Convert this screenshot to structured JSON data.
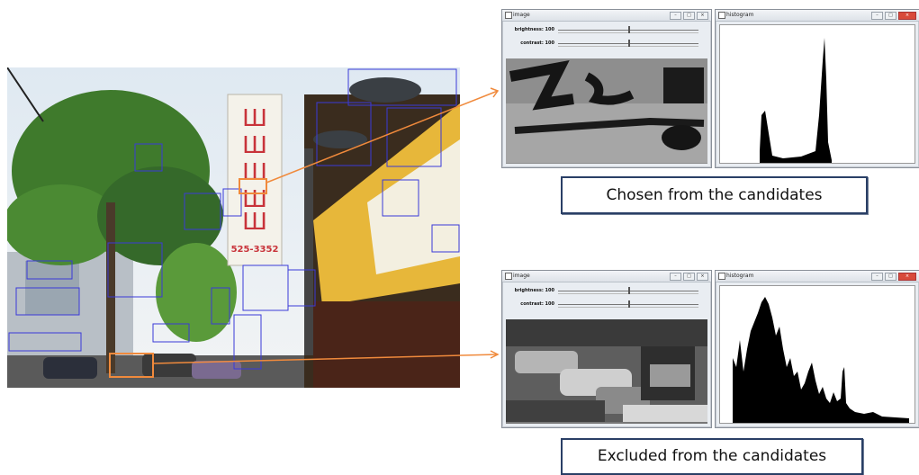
{
  "photo": {
    "sign_phone": "525-3352"
  },
  "top_row": {
    "image_window": {
      "title": "image",
      "trackbars": [
        {
          "label": "brightness: 100",
          "fraction": 0.5
        },
        {
          "label": "contrast: 100",
          "fraction": 0.5
        }
      ]
    },
    "histogram_window": {
      "title": "histogram"
    },
    "caption": "Chosen from the candidates"
  },
  "bottom_row": {
    "image_window": {
      "title": "image",
      "trackbars": [
        {
          "label": "brightness: 100",
          "fraction": 0.5
        },
        {
          "label": "contrast: 100",
          "fraction": 0.5
        }
      ]
    },
    "histogram_window": {
      "title": "histogram"
    },
    "caption": "Excluded from the candidates"
  },
  "window_buttons": {
    "minimize": "–",
    "maximize": "□",
    "close": "×"
  },
  "colors": {
    "candidate_box": "#3a3ad8",
    "selected_box": "#f08a3c",
    "caption_border": "#2a3f66"
  }
}
